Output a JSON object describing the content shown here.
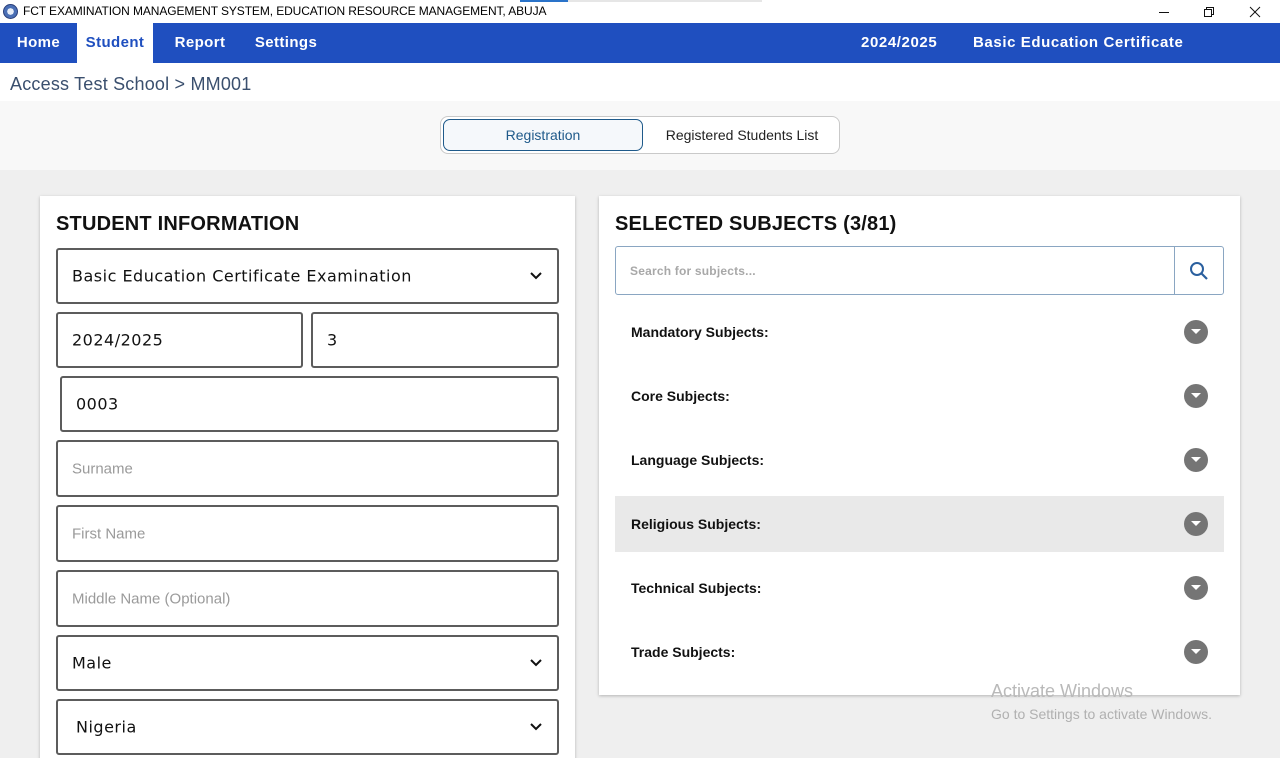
{
  "window": {
    "title": "FCT EXAMINATION MANAGEMENT SYSTEM, EDUCATION RESOURCE MANAGEMENT, ABUJA",
    "controls": [
      "minimize-icon",
      "restore-icon",
      "close-icon"
    ]
  },
  "nav": {
    "items": [
      {
        "label": "Home",
        "active": false
      },
      {
        "label": "Student",
        "active": true
      },
      {
        "label": "Report",
        "active": false
      },
      {
        "label": "Settings",
        "active": false
      }
    ],
    "session": "2024/2025",
    "exam": "Basic Education Certificate Examination",
    "color": "#1f4fbf"
  },
  "breadcrumb": "Access Test School > MM001",
  "tabs": {
    "registration": "Registration",
    "registered_list": "Registered Students List",
    "active": "Registration"
  },
  "student_info": {
    "title": "STUDENT INFORMATION",
    "exam_select": "Basic Education Certificate Examination",
    "session": "2024/2025",
    "class_value": "3",
    "serial": "0003",
    "surname_placeholder": "Surname",
    "first_name_placeholder": "First Name",
    "middle_name_placeholder": "Middle Name (Optional)",
    "gender_select": "Male",
    "nationality_select": "Nigeria"
  },
  "subjects": {
    "title": "SELECTED SUBJECTS (3/81)",
    "search_placeholder": "Search for subjects...",
    "groups": [
      {
        "label": "Mandatory Subjects:"
      },
      {
        "label": "Core Subjects:"
      },
      {
        "label": "Language Subjects:"
      },
      {
        "label": "Religious Subjects:",
        "highlighted": true
      },
      {
        "label": "Technical Subjects:"
      },
      {
        "label": "Trade Subjects:"
      }
    ]
  },
  "watermark": {
    "title": "Activate Windows",
    "subtitle": "Go to Settings to activate Windows."
  }
}
